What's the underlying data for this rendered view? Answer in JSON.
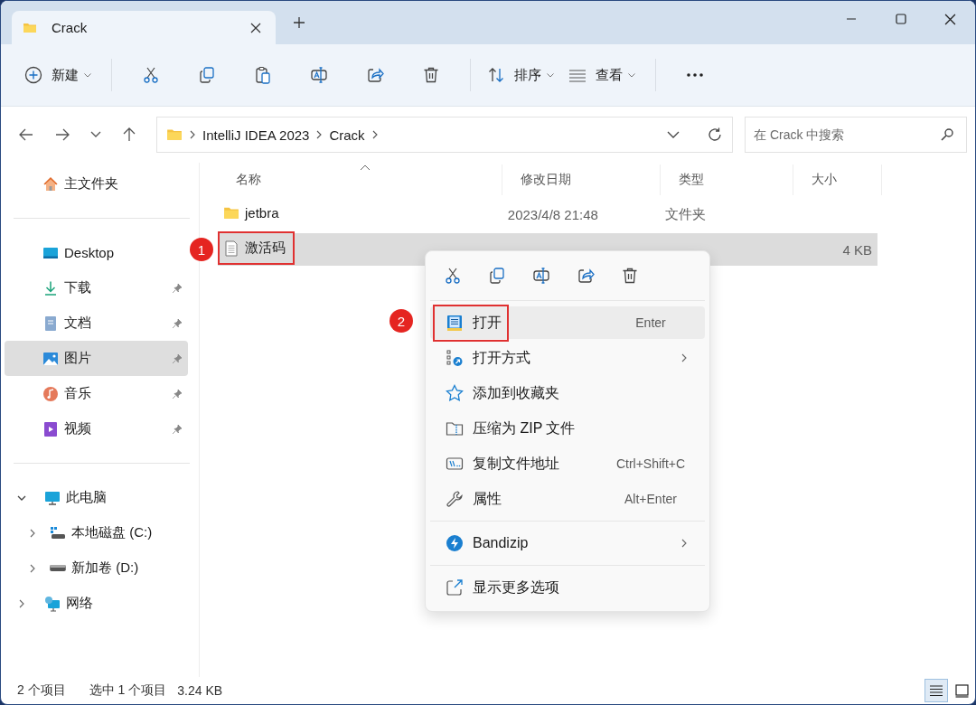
{
  "window": {
    "tab_title": "Crack"
  },
  "toolbar": {
    "new_label": "新建",
    "sort_label": "排序",
    "view_label": "查看"
  },
  "address": {
    "path": [
      "IntelliJ IDEA 2023",
      "Crack"
    ]
  },
  "search": {
    "placeholder": "在 Crack 中搜索"
  },
  "sidebar": {
    "home": [
      {
        "kind": "home",
        "label": "主文件夹",
        "selected": false
      }
    ],
    "quick_access": [
      {
        "kind": "desktop",
        "label": "Desktop",
        "pinned": false,
        "selected": false
      },
      {
        "kind": "download",
        "label": "下载",
        "pinned": true,
        "selected": false
      },
      {
        "kind": "documents",
        "label": "文档",
        "pinned": true,
        "selected": false
      },
      {
        "kind": "pictures",
        "label": "图片",
        "pinned": true,
        "selected": true
      },
      {
        "kind": "music",
        "label": "音乐",
        "pinned": true,
        "selected": false
      },
      {
        "kind": "videos",
        "label": "视频",
        "pinned": true,
        "selected": false
      }
    ],
    "tree": [
      {
        "kind": "pc",
        "label": "此电脑",
        "expanded": true,
        "selected": false,
        "children": [
          {
            "kind": "drive-c",
            "label": "本地磁盘 (C:)",
            "expanded": false,
            "selected": false
          },
          {
            "kind": "drive",
            "label": "新加卷 (D:)",
            "expanded": false,
            "selected": false
          }
        ]
      },
      {
        "kind": "network",
        "label": "网络",
        "expanded": false,
        "selected": false
      }
    ]
  },
  "columns": [
    {
      "label": "名称",
      "sorted": true
    },
    {
      "label": "修改日期",
      "sorted": false
    },
    {
      "label": "类型",
      "sorted": false
    },
    {
      "label": "大小",
      "sorted": false
    }
  ],
  "files": [
    {
      "kind": "folder",
      "name": "jetbra",
      "date": "2023/4/8 21:48",
      "type": "文件夹",
      "selected": false
    },
    {
      "kind": "text",
      "name": "激活码",
      "size": "4 KB",
      "selected": true,
      "annotation": "1"
    }
  ],
  "context_menu": {
    "groups": [
      [
        {
          "kind": "notepad",
          "label": "打开",
          "shortcut": "Enter",
          "selected": true,
          "annotation": "2"
        },
        {
          "kind": "open-with",
          "label": "打开方式",
          "submenu": true,
          "selected": false
        },
        {
          "kind": "star",
          "label": "添加到收藏夹",
          "selected": false
        },
        {
          "kind": "zip",
          "label": "压缩为 ZIP 文件",
          "selected": false
        },
        {
          "kind": "path",
          "label": "复制文件地址",
          "shortcut": "Ctrl+Shift+C",
          "selected": false
        },
        {
          "kind": "wrench",
          "label": "属性",
          "shortcut": "Alt+Enter",
          "selected": false
        }
      ],
      [
        {
          "kind": "bandizip",
          "label": "Bandizip",
          "submenu": true,
          "selected": false
        }
      ],
      [
        {
          "kind": "more",
          "label": "显示更多选项",
          "selected": false
        }
      ]
    ]
  },
  "status_bar": {
    "count": "2 个项目",
    "selection": "选中 1 个项目",
    "size": "3.24 KB",
    "view_buttons": [
      {
        "kind": "details",
        "selected": true
      },
      {
        "kind": "tiles",
        "selected": false
      }
    ]
  }
}
